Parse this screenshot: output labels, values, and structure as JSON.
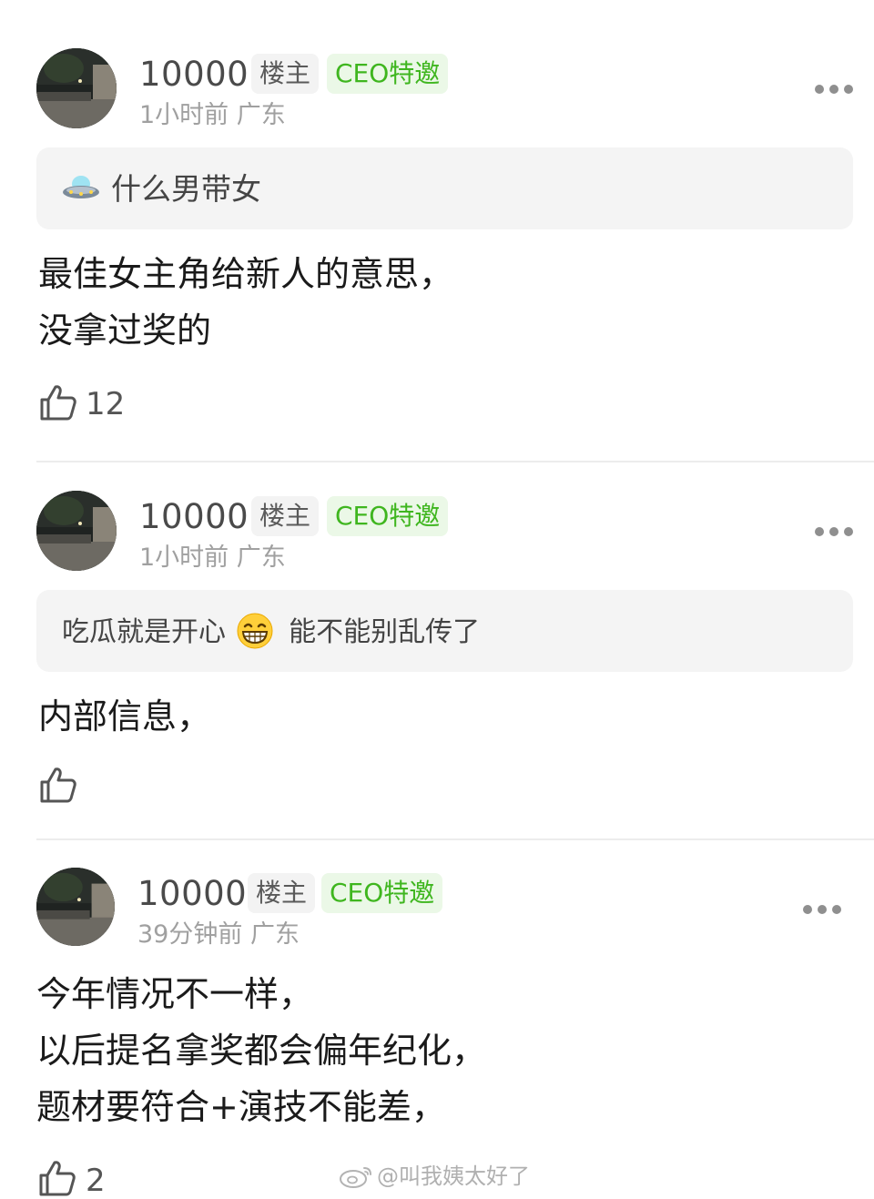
{
  "comments": [
    {
      "username": "10000",
      "owner_badge": "楼主",
      "ceo_badge": "CEO特邀",
      "time": "1小时前",
      "location": "广东",
      "quote": {
        "icon": "ufo-emoji-icon",
        "text": "什么男带女"
      },
      "lines": [
        "最佳女主角给新人的意思，",
        "没拿过奖的"
      ],
      "likes": "12"
    },
    {
      "username": "10000",
      "owner_badge": "楼主",
      "ceo_badge": "CEO特邀",
      "time": "1小时前",
      "location": "广东",
      "quote": {
        "text_before": "吃瓜就是开心",
        "icon": "grinning-emoji-icon",
        "text_after": "能不能别乱传了"
      },
      "lines": [
        "内部信息，"
      ],
      "likes": ""
    },
    {
      "username": "10000",
      "owner_badge": "楼主",
      "ceo_badge": "CEO特邀",
      "time": "39分钟前",
      "location": "广东",
      "lines": [
        "今年情况不一样，",
        "以后提名拿奖都会偏年纪化，",
        "题材要符合+演技不能差，"
      ],
      "likes": "2"
    }
  ],
  "watermark": "@叫我姨太好了",
  "colors": {
    "ceo_green": "#3fb61f",
    "ceo_bg": "#ebf8e7",
    "quote_bg": "#f4f4f4",
    "meta_gray": "#a0a0a0"
  }
}
